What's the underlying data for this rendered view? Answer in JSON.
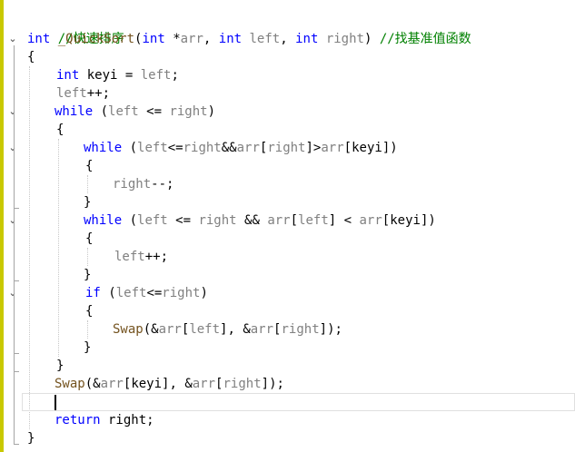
{
  "colors": {
    "keyword": "#0000ff",
    "comment": "#008000",
    "identifier": "#808080",
    "function": "#74531f",
    "text": "#000000",
    "change_bar": "#c8c800"
  },
  "code": {
    "line1_comment": "//快速排序",
    "line2_kw_int": "int",
    "line2_funcname": "_QuickSort",
    "line2_paren_open": "(",
    "line2_kw_int2": "int",
    "line2_star": " *",
    "line2_arr": "arr",
    "line2_comma1": ", ",
    "line2_kw_int3": "int",
    "line2_left": " left",
    "line2_comma2": ", ",
    "line2_kw_int4": "int",
    "line2_right": " right",
    "line2_paren_close": ") ",
    "line2_comment": "//找基准值函数",
    "line3_brace": "{",
    "line4_kw_int": "int",
    "line4_keyi": " keyi",
    "line4_eq": " = ",
    "line4_left": "left",
    "line4_semi": ";",
    "line5_left": "left",
    "line5_op": "++;",
    "line6_kw_while": "while",
    "line6_open": " (",
    "line6_left": "left",
    "line6_le": " <= ",
    "line6_right": "right",
    "line6_close": ")",
    "line7_brace": "{",
    "line8_kw_while": "while",
    "line8_open": " (",
    "line8_left": "left",
    "line8_le": "<=",
    "line8_right": "right",
    "line8_and": "&&",
    "line8_arr1": "arr",
    "line8_br1o": "[",
    "line8_right2": "right",
    "line8_br1c": "]>",
    "line8_arr2": "arr",
    "line8_br2o": "[",
    "line8_keyi": "keyi",
    "line8_br2c": "])",
    "line9_brace": "{",
    "line10_right": "right",
    "line10_op": "--;",
    "line11_brace": "}",
    "line12_kw_while": "while",
    "line12_open": " (",
    "line12_left": "left",
    "line12_le": " <= ",
    "line12_right": "right",
    "line12_and": " && ",
    "line12_arr1": "arr",
    "line12_br1o": "[",
    "line12_left2": "left",
    "line12_br1c": "] < ",
    "line12_arr2": "arr",
    "line12_br2o": "[",
    "line12_keyi": "keyi",
    "line12_br2c": "])",
    "line13_brace": "{",
    "line14_left": "left",
    "line14_op": "++;",
    "line15_brace": "}",
    "line16_kw_if": "if",
    "line16_open": " (",
    "line16_left": "left",
    "line16_le": "<=",
    "line16_right": "right",
    "line16_close": ")",
    "line17_brace": "{",
    "line18_swap": "Swap",
    "line18_p1": "(&",
    "line18_arr1": "arr",
    "line18_b1o": "[",
    "line18_left": "left",
    "line18_b1c": "], &",
    "line18_arr2": "arr",
    "line18_b2o": "[",
    "line18_right": "right",
    "line18_b2c": "]);",
    "line19_brace": "}",
    "line20_brace": "}",
    "line21_swap": "Swap",
    "line21_p1": "(&",
    "line21_arr1": "arr",
    "line21_b1o": "[",
    "line21_keyi": "keyi",
    "line21_b1c": "], &",
    "line21_arr2": "arr",
    "line21_b2o": "[",
    "line21_right": "right",
    "line21_b2c": "]);",
    "line23_kw_return": "return",
    "line23_right": " right",
    "line23_semi": ";",
    "line24_brace": "}"
  },
  "icons": {
    "fold_toggle": "chevron-down-icon",
    "fold_glyph": "⌄"
  }
}
